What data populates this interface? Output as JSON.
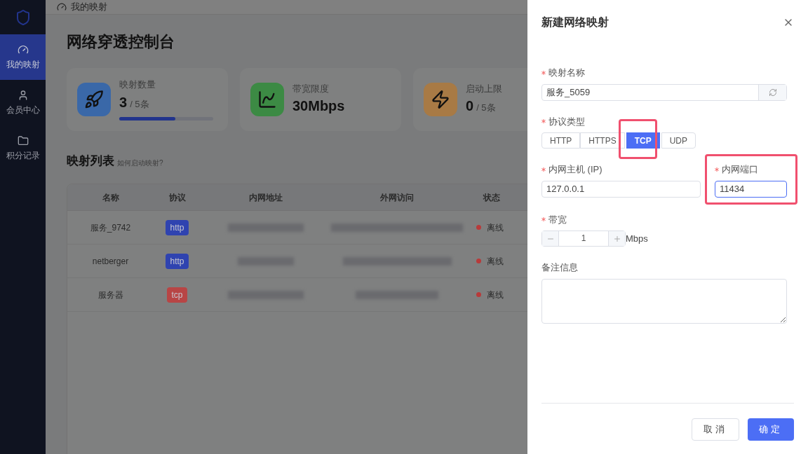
{
  "sidebar": {
    "items": [
      {
        "label": "我的映射",
        "kind": "gauge",
        "selected": true
      },
      {
        "label": "会员中心",
        "kind": "user",
        "selected": false
      },
      {
        "label": "积分记录",
        "kind": "folder",
        "selected": false
      }
    ]
  },
  "breadcrumb": "我的映射",
  "page_title": "网络穿透控制台",
  "stats": [
    {
      "kind": "count",
      "label": "映射数量",
      "value": "3",
      "unit": "/ 5条",
      "level": 0.6
    },
    {
      "kind": "bandwidth",
      "label": "带宽限度",
      "value": "30Mbps"
    },
    {
      "kind": "limit",
      "label": "启动上限",
      "value": "0",
      "unit": "/ 5条"
    }
  ],
  "list": {
    "title": "映射列表",
    "help_link": "如何启动映射?"
  },
  "table": {
    "columns": [
      "名称",
      "协议",
      "内网地址",
      "外网访问",
      "状态"
    ],
    "rows": [
      {
        "name": "服务_9742",
        "protocol": {
          "label": "http",
          "color": "#2f43b0"
        },
        "internal_address": {
          "redacted": true
        },
        "public_access": {
          "redacted": true
        },
        "status": {
          "label": "离线",
          "color": "#b83a3a"
        }
      },
      {
        "name": "netberger",
        "protocol": {
          "label": "http",
          "color": "#2f43b0"
        },
        "internal_address": {
          "redacted": true
        },
        "public_access": {
          "redacted": true
        },
        "status": {
          "label": "离线",
          "color": "#b83a3a"
        }
      },
      {
        "name": "服务器",
        "protocol": {
          "label": "tcp",
          "color": "#b84545"
        },
        "internal_address": {
          "redacted": true
        },
        "public_access": {
          "redacted": true
        },
        "status": {
          "label": "离线",
          "color": "#b83a3a"
        }
      }
    ]
  },
  "drawer": {
    "title": "新建网络映射",
    "name_field": {
      "label": "映射名称",
      "required": true,
      "value": "服务_5059"
    },
    "protocol_field": {
      "label": "协议类型",
      "required": true,
      "highlighted": true,
      "options": [
        {
          "label": "HTTP",
          "selected": false
        },
        {
          "label": "HTTPS",
          "selected": false
        },
        {
          "label": "TCP",
          "selected": true
        },
        {
          "label": "UDP",
          "selected": false
        }
      ]
    },
    "host_field": {
      "label": "内网主机 (IP)",
      "required": true,
      "value": "127.0.0.1"
    },
    "port_field": {
      "label": "内网端口",
      "required": true,
      "value": "11434",
      "focused": true,
      "highlighted": true
    },
    "bandwidth_field": {
      "label": "带宽",
      "required": true,
      "value": "1",
      "unit": "Mbps"
    },
    "notes_field": {
      "label": "备注信息",
      "required": false
    },
    "buttons": [
      {
        "label": "取消",
        "kind": "secondary"
      },
      {
        "label": "确定",
        "kind": "primary"
      }
    ]
  }
}
